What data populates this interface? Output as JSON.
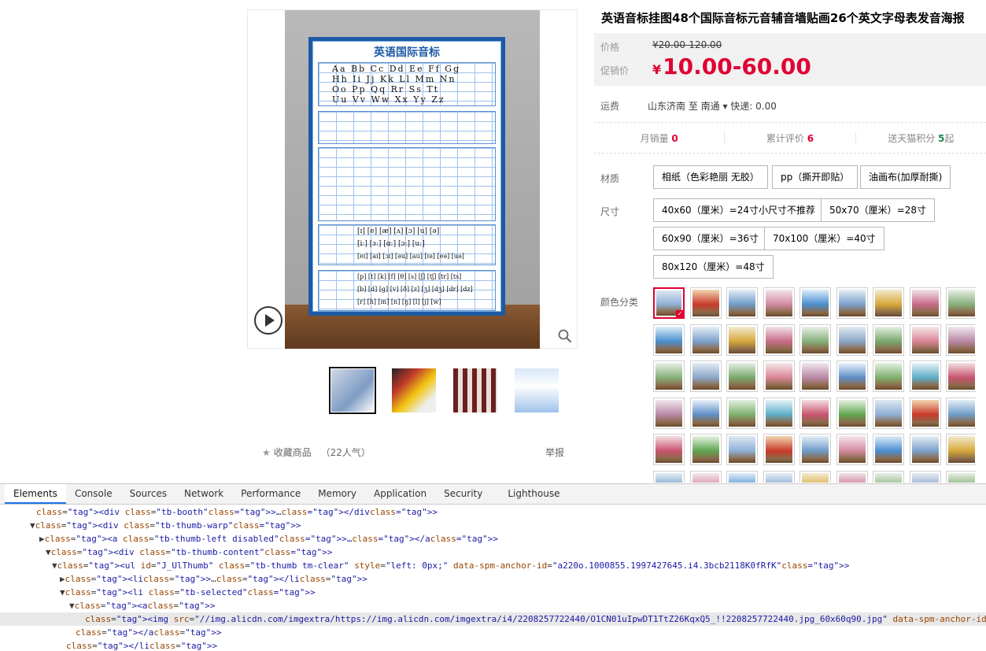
{
  "product": {
    "title": "英语音标挂图48个国际音标元音辅音墙贴画26个英文字母表发音海报",
    "poster_title": "英语国际音标",
    "poster_rows": [
      "Aa Bb Cc Dd Ee Ff Gg",
      "Hh Ii Jj Kk Ll Mm Nn",
      "Oo Pp Qq    Rr Ss Tt",
      "Uu Vv Ww    Xx Yy Zz",
      "[ɪ] [e] [æ] [ʌ] [ɔ] [u] [ə]",
      "[iː] [ɜː] [ɑː] [ɔː] [uː]",
      "[eɪ] [aɪ] [ɔɪ] [əu] [au] [ɪə] [eə] [uə]",
      "[p] [t] [k] [f] [θ] [s] [ʃ] [tʃ] [tr] [ts]",
      "[b] [d] [g] [v] [ð] [z] [ʒ] [dʒ] [dr] [dz]",
      "[r] [h] [m] [n] [ŋ] [l] [j] [w]"
    ]
  },
  "price": {
    "label": "价格",
    "original": "¥20.00-120.00",
    "promo_label": "促销价",
    "yen": "¥",
    "promo": "10.00-60.00"
  },
  "shipping": {
    "label": "运费",
    "value": "山东济南  至 南通 ▾ 快递: 0.00"
  },
  "stats": [
    {
      "label": "月销量",
      "value": "0",
      "suffix": ""
    },
    {
      "label": "累计评价",
      "value": "6",
      "suffix": ""
    },
    {
      "label": "送天猫积分",
      "value": "5",
      "suffix": "起"
    }
  ],
  "material": {
    "label": "材质",
    "options": [
      "相纸（色彩艳丽 无胶）",
      "pp（撕开即贴）",
      "油画布(加厚耐撕)"
    ]
  },
  "size": {
    "label": "尺寸",
    "options": [
      "40x60（厘米）=24寸小尺寸不推荐",
      "50x70（厘米）=28寸",
      "60x90（厘米）=36寸",
      "70x100（厘米）=40寸",
      "80x120（厘米）=48寸"
    ]
  },
  "color": {
    "label": "颜色分类",
    "check": "✓"
  },
  "favorite": {
    "star": "★",
    "label": "收藏商品",
    "count": "（22人气）",
    "report": "举报"
  },
  "devtools": {
    "tabs": [
      "Elements",
      "Console",
      "Sources",
      "Network",
      "Performance",
      "Memory",
      "Application",
      "Security",
      "Lighthouse"
    ],
    "lines": [
      {
        "t": "&lt;div class=\"tb-booth\"&gt;…&lt;/div&gt;"
      },
      {
        "t": "▼&lt;div class=\"tb-thumb-warp\"&gt;"
      },
      {
        "t": "▶&lt;a class=\"tb-thumb-left disabled\"&gt;…&lt;/a&gt;"
      },
      {
        "t": "▼&lt;div class=\"tb-thumb-content\"&gt;"
      },
      {
        "t": "▼&lt;ul id=\"J_UlThumb\" class=\"tb-thumb tm-clear\" style=\"left: 0px;\" data-spm-anchor-id=\"a220o.1000855.1997427645.i4.3bcb2118K0fRfK\"&gt;"
      },
      {
        "t": "▶&lt;li&gt;…&lt;/li&gt;"
      },
      {
        "t": "▼&lt;li class=\"tb-selected\"&gt;"
      },
      {
        "t": "▼&lt;a&gt;"
      },
      {
        "t": "&lt;img src=\"//img.alicdn.com/imgextra/https://img.alicdn.com/imgextra/i4/2208257722440/O1CN01uIpwDT1TtZ26KqxQ5_!!2208257722440.jpg_60x60q90.jpg\" data-spm-anchor-id=\"a220o.10008"
      },
      {
        "t": "&lt;/a&gt;"
      },
      {
        "t": "&lt;/li&gt;"
      },
      {
        "t": "▶&lt;li&gt;…&lt;/li&gt;"
      }
    ]
  },
  "colors": {
    "price_red": "#e00033",
    "tab_blue": "#1a73e8",
    "poster_blue": "#1d5aa6"
  }
}
